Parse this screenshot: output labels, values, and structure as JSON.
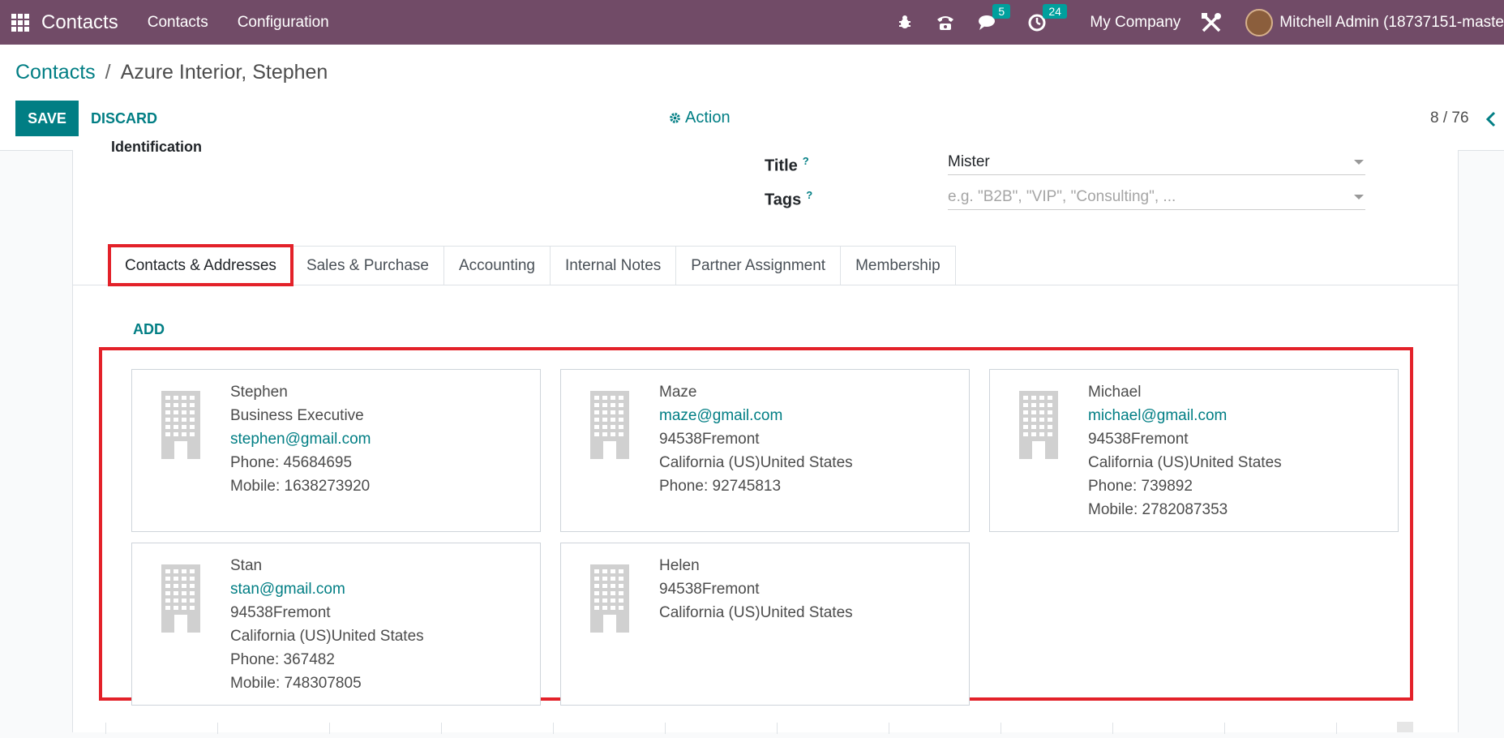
{
  "topbar": {
    "app_title": "Contacts",
    "menu": [
      "Contacts",
      "Configuration"
    ],
    "messages_count": "5",
    "activities_count": "24",
    "company": "My Company",
    "user": "Mitchell Admin (18737151-maste"
  },
  "breadcrumb": {
    "parent": "Contacts",
    "separator": "/",
    "current": "Azure Interior, Stephen"
  },
  "buttons": {
    "save": "SAVE",
    "discard": "DISCARD",
    "action": "Action",
    "add": "ADD"
  },
  "pager": "8 / 76",
  "form": {
    "identification_label": "Identification",
    "title_label": "Title",
    "title_value": "Mister",
    "tags_label": "Tags",
    "tags_placeholder": "e.g. \"B2B\", \"VIP\", \"Consulting\", ...",
    "help_mark": "?"
  },
  "tabs": [
    "Contacts & Addresses",
    "Sales & Purchase",
    "Accounting",
    "Internal Notes",
    "Partner Assignment",
    "Membership"
  ],
  "contacts": [
    {
      "lines": [
        "Stephen",
        "Business Executive",
        "stephen@gmail.com",
        "Phone: 45684695",
        "Mobile: 1638273920"
      ],
      "email_line": 2
    },
    {
      "lines": [
        "Maze",
        "maze@gmail.com",
        "94538Fremont",
        "California (US)United States",
        "Phone: 92745813"
      ],
      "email_line": 1
    },
    {
      "lines": [
        "Michael",
        "michael@gmail.com",
        "94538Fremont",
        "California (US)United States",
        "Phone: 739892",
        "Mobile: 2782087353"
      ],
      "email_line": 1
    },
    {
      "lines": [
        "Stan",
        "stan@gmail.com",
        "94538Fremont",
        "California (US)United States",
        "Phone: 367482",
        "Mobile: 748307805"
      ],
      "email_line": 1
    },
    {
      "lines": [
        "Helen",
        "94538Fremont",
        "California (US)United States"
      ],
      "email_line": -1
    }
  ],
  "colors": {
    "brand": "#714B67",
    "accent": "#017e84",
    "highlight": "#e32129"
  }
}
